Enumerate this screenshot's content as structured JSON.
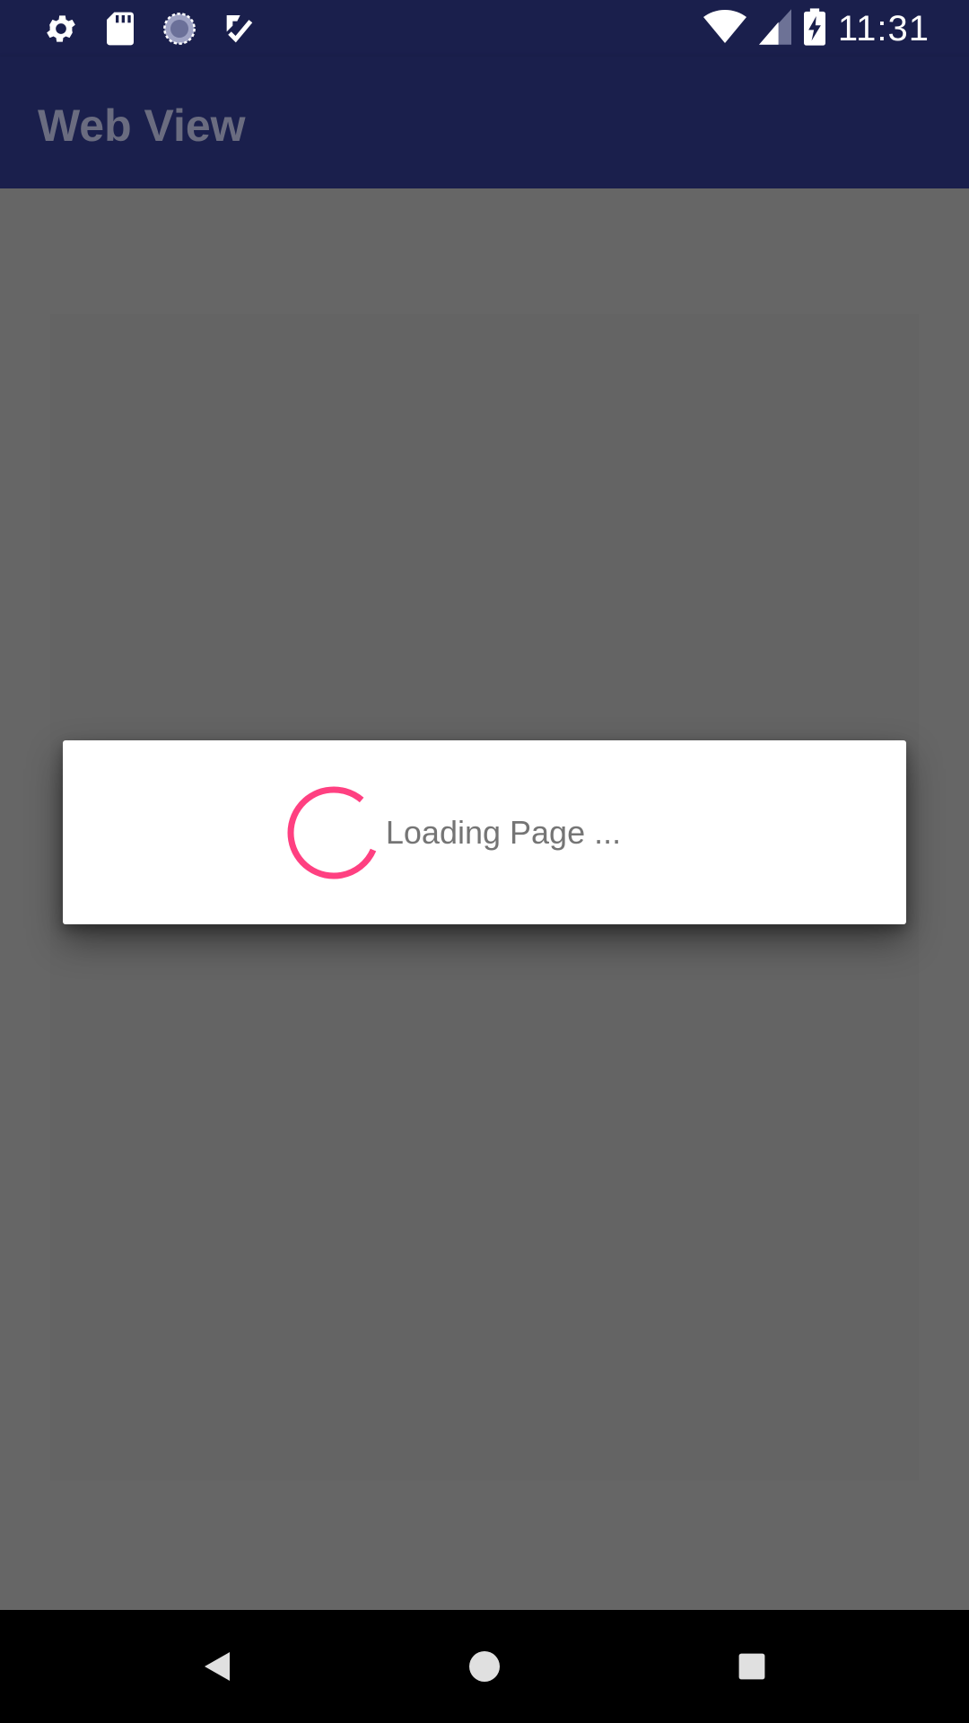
{
  "status_bar": {
    "time": "11:31",
    "left_icons": [
      "gear-icon",
      "sd-card-icon",
      "sync-circle-icon",
      "task-check-icon"
    ],
    "right_icons": [
      "wifi-icon",
      "cell-signal-icon",
      "battery-charging-icon"
    ]
  },
  "app_bar": {
    "title": "Web View"
  },
  "dialog": {
    "message": "Loading Page ..."
  },
  "colors": {
    "primary_dark": "#1a1f4c",
    "accent": "#ff4081",
    "dialog_text": "#757575"
  },
  "nav_bar": {
    "buttons": [
      "back-icon",
      "home-icon",
      "recents-icon"
    ]
  }
}
